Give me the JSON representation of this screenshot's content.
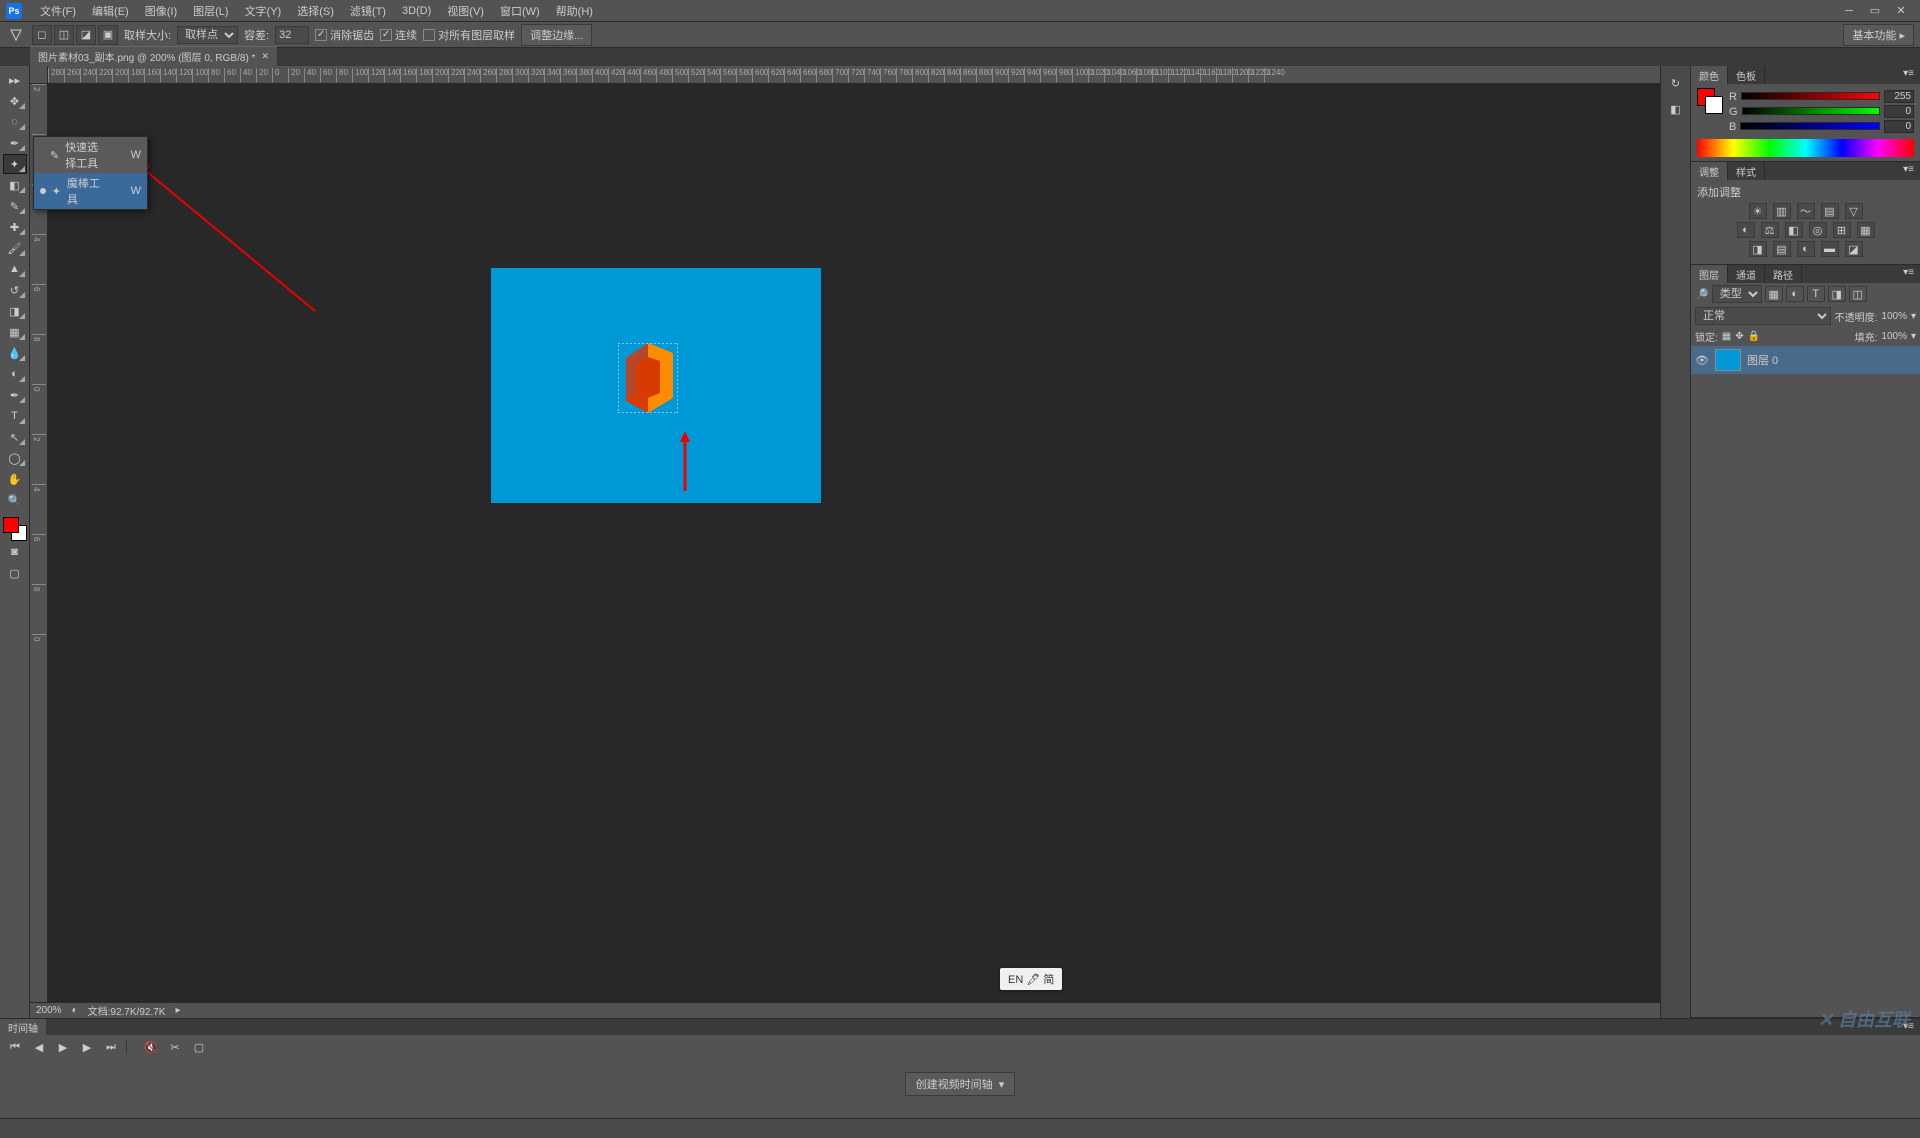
{
  "menubar": {
    "items": [
      "文件(F)",
      "编辑(E)",
      "图像(I)",
      "图层(L)",
      "文字(Y)",
      "选择(S)",
      "滤镜(T)",
      "3D(D)",
      "视图(V)",
      "窗口(W)",
      "帮助(H)"
    ]
  },
  "optionbar": {
    "sample_label": "取样大小:",
    "sample_value": "取样点",
    "tolerance_label": "容差:",
    "tolerance_value": "32",
    "antialias": "消除锯齿",
    "contiguous": "连续",
    "all_layers": "对所有图层取样",
    "refine": "调整边缘...",
    "workspace": "基本功能"
  },
  "doc_tab": {
    "title": "图片素材03_副本.png @ 200% (图层 0, RGB/8) *"
  },
  "ruler_h": [
    "280",
    "260",
    "240",
    "220",
    "200",
    "180",
    "160",
    "140",
    "120",
    "100",
    "80",
    "60",
    "40",
    "20",
    "0",
    "20",
    "40",
    "60",
    "80",
    "100",
    "120",
    "140",
    "160",
    "180",
    "200",
    "220",
    "240",
    "260",
    "280",
    "300",
    "320",
    "340",
    "360",
    "380",
    "400",
    "420",
    "440",
    "460",
    "480",
    "500",
    "520",
    "540",
    "560",
    "580",
    "600",
    "620",
    "640",
    "660",
    "680",
    "700",
    "720",
    "740",
    "760",
    "780",
    "800",
    "820",
    "840",
    "860",
    "880",
    "900",
    "920",
    "940",
    "960",
    "980",
    "1000",
    "1020",
    "1040",
    "1060",
    "1080",
    "1100",
    "1120",
    "1140",
    "1160",
    "1180",
    "1200",
    "1220",
    "1240"
  ],
  "ruler_v": [
    "2",
    "0",
    "2",
    "4",
    "6",
    "8",
    "0",
    "2",
    "4",
    "6",
    "8",
    "0"
  ],
  "flyout": {
    "items": [
      {
        "label": "快速选择工具",
        "key": "W",
        "selected": false
      },
      {
        "label": "魔棒工具",
        "key": "W",
        "selected": true
      }
    ]
  },
  "canvas_status": {
    "zoom": "200%",
    "docinfo": "文档:92.7K/92.7K"
  },
  "panels": {
    "color": {
      "tabs": [
        "颜色",
        "色板"
      ],
      "r_label": "R",
      "g_label": "G",
      "b_label": "B",
      "r": "255",
      "g": "0",
      "b": "0"
    },
    "adjust": {
      "tabs": [
        "调整",
        "样式"
      ],
      "title": "添加调整"
    },
    "layers": {
      "tabs": [
        "图层",
        "通道",
        "路径"
      ],
      "filter_label": "类型",
      "blend": "正常",
      "opacity_label": "不透明度:",
      "opacity": "100%",
      "lock_label": "锁定:",
      "fill_label": "填充:",
      "fill": "100%",
      "layer0": "图层 0"
    }
  },
  "timeline": {
    "tab": "时间轴",
    "create": "创建视频时间轴"
  },
  "ime": "EN 🖊 简",
  "watermark": "自由互联"
}
